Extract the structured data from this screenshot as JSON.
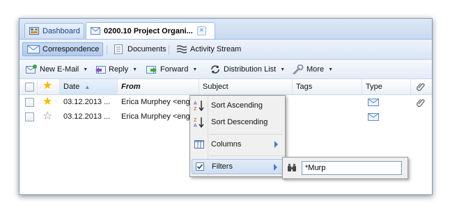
{
  "doc_tabs": [
    {
      "label": "Dashboard",
      "icon": "dashboard-icon"
    },
    {
      "label": "0200.10 Project Organi...",
      "icon": "mail-icon"
    }
  ],
  "sub_tabs": [
    {
      "label": "Correspondence",
      "icon": "mail-icon"
    },
    {
      "label": "Documents",
      "icon": "document-icon"
    },
    {
      "label": "Activity Stream",
      "icon": "activity-icon"
    }
  ],
  "toolbar": {
    "new_email": "New E-Mail",
    "reply": "Reply",
    "forward": "Forward",
    "distribution_list": "Distribution List",
    "more": "More"
  },
  "grid": {
    "columns": {
      "date": "Date",
      "from": "From",
      "subject": "Subject",
      "tags": "Tags",
      "type": "Type"
    },
    "rows": [
      {
        "date": "03.12.2013 ...",
        "from": "Erica Murphey <eng",
        "starred": true,
        "attachment": true
      },
      {
        "date": "03.12.2013 ...",
        "from": "Erica Murphey <eng",
        "starred": false,
        "attachment": false
      }
    ]
  },
  "context_menu": {
    "sort_ascending": "Sort Ascending",
    "sort_descending": "Sort Descending",
    "columns": "Columns",
    "filters": "Filters"
  },
  "filter": {
    "value": "*Murp"
  },
  "colors": {
    "accent": "#15428b",
    "border": "#99bbe8",
    "star": "#f5b800"
  }
}
